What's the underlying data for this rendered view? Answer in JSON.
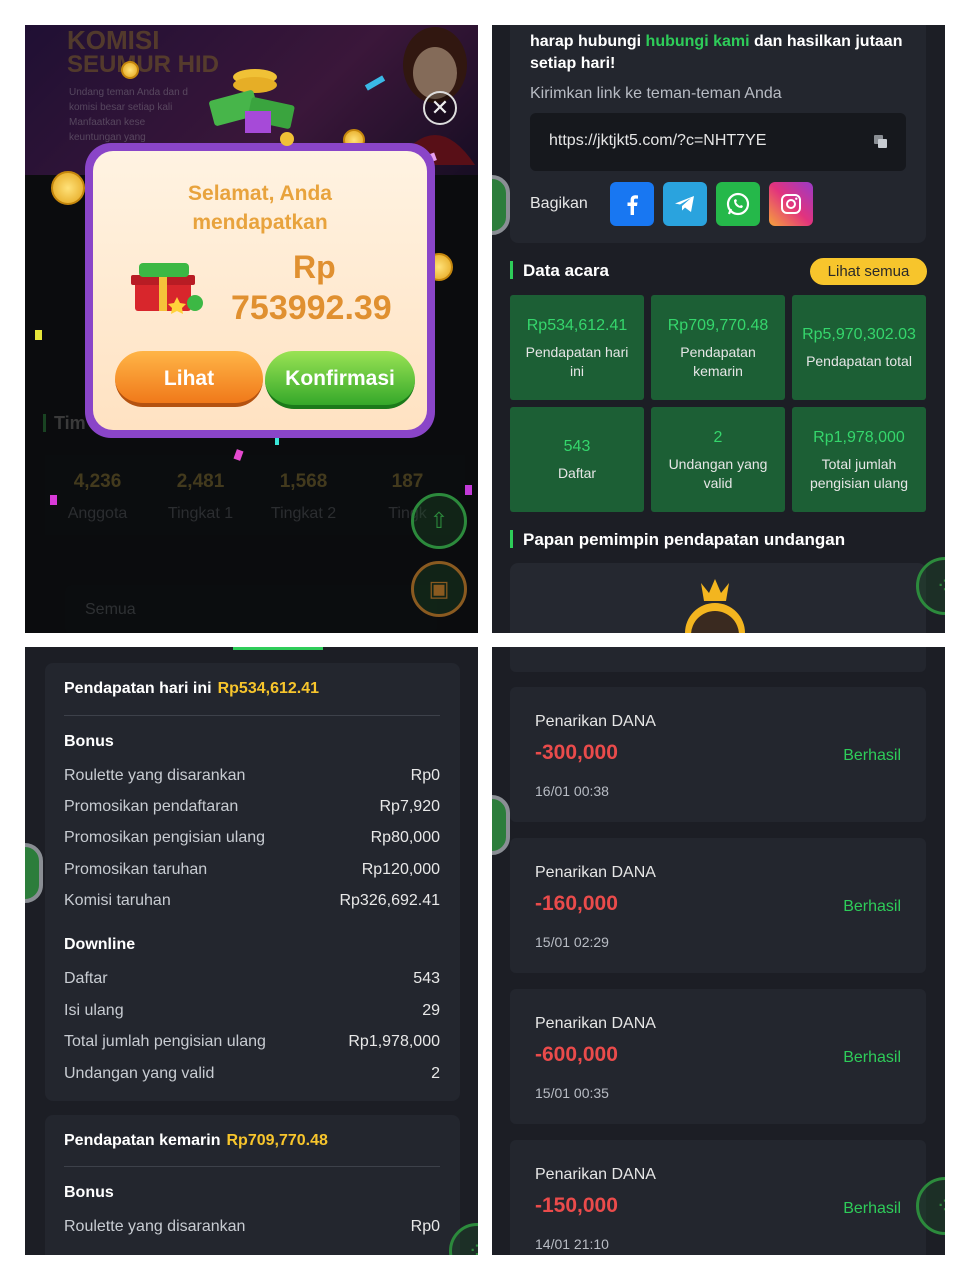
{
  "panel1": {
    "banner": {
      "title_line1": "KOMISI",
      "title_line2": "SEUMUR HID",
      "desc_line1": "Undang teman Anda dan d",
      "desc_line2": "komisi besar setiap kali",
      "desc_line3": "Manfaatkan kese",
      "desc_line4": "keuntungan yang"
    },
    "team_label": "Tim",
    "stats": [
      {
        "value": "4,236",
        "label": "Anggota"
      },
      {
        "value": "2,481",
        "label": "Tingkat 1"
      },
      {
        "value": "1,568",
        "label": "Tingkat 2"
      },
      {
        "value": "187",
        "label": "Tingk"
      }
    ],
    "select_value": "Semua",
    "modal": {
      "title_line1": "Selamat, Anda",
      "title_line2": "mendapatkan",
      "currency": "Rp",
      "amount": "753992.39",
      "view_button": "Lihat",
      "confirm_button": "Konfirmasi"
    }
  },
  "panel2": {
    "intro_line1_prefix": "harap hubungi ",
    "intro_line1_link": "hubungi kami",
    "intro_line1_suffix": " dan hasilkan jutaan",
    "intro_line2": "setiap hari!",
    "send_link_label": "Kirimkan link ke teman-teman Anda",
    "invite_link": "https://jktjkt5.com/?c=NHT7YE",
    "share_label": "Bagikan",
    "social": [
      {
        "name": "facebook",
        "color": "#1877f2"
      },
      {
        "name": "telegram",
        "color": "#2aa3de"
      },
      {
        "name": "whatsapp",
        "color": "#25b84a"
      },
      {
        "name": "instagram",
        "color": "#e43d8e"
      }
    ],
    "event_title": "Data acara",
    "see_all": "Lihat semua",
    "event_stats": [
      {
        "value": "Rp534,612.41",
        "label": "Pendapatan hari ini"
      },
      {
        "value": "Rp709,770.48",
        "label": "Pendapatan kemarin"
      },
      {
        "value": "Rp5,970,302.03",
        "label": "Pendapatan total"
      },
      {
        "value": "543",
        "label": "Daftar"
      },
      {
        "value": "2",
        "label": "Undangan yang valid"
      },
      {
        "value": "Rp1,978,000",
        "label": "Total jumlah pengisian ulang"
      }
    ],
    "leaderboard_title": "Papan pemimpin pendapatan undangan"
  },
  "panel3": {
    "today": {
      "label": "Pendapatan hari ini",
      "value": "Rp534,612.41",
      "bonus_title": "Bonus",
      "bonus_rows": [
        {
          "label": "Roulette yang disarankan",
          "value": "Rp0"
        },
        {
          "label": "Promosikan pendaftaran",
          "value": "Rp7,920"
        },
        {
          "label": "Promosikan pengisian ulang",
          "value": "Rp80,000"
        },
        {
          "label": "Promosikan taruhan",
          "value": "Rp120,000"
        },
        {
          "label": "Komisi taruhan",
          "value": "Rp326,692.41"
        }
      ],
      "downline_title": "Downline",
      "downline_rows": [
        {
          "label": "Daftar",
          "value": "543"
        },
        {
          "label": "Isi ulang",
          "value": "29"
        },
        {
          "label": "Total jumlah pengisian ulang",
          "value": "Rp1,978,000"
        },
        {
          "label": "Undangan yang valid",
          "value": "2"
        }
      ]
    },
    "yesterday": {
      "label": "Pendapatan kemarin",
      "value": "Rp709,770.48",
      "bonus_title": "Bonus",
      "bonus_rows": [
        {
          "label": "Roulette yang disarankan",
          "value": "Rp0"
        }
      ]
    }
  },
  "panel4": {
    "withdrawals": [
      {
        "title": "Penarikan DANA",
        "amount": "-300,000",
        "status": "Berhasil",
        "date": "16/01 00:38"
      },
      {
        "title": "Penarikan DANA",
        "amount": "-160,000",
        "status": "Berhasil",
        "date": "15/01 02:29"
      },
      {
        "title": "Penarikan DANA",
        "amount": "-600,000",
        "status": "Berhasil",
        "date": "15/01 00:35"
      },
      {
        "title": "Penarikan DANA",
        "amount": "-150,000",
        "status": "Berhasil",
        "date": "14/01 21:10"
      }
    ]
  },
  "colors": {
    "accent_green": "#2ecc59",
    "accent_yellow": "#f7c52c",
    "negative_red": "#ea4b4b",
    "modal_purple": "#8a45c8"
  }
}
